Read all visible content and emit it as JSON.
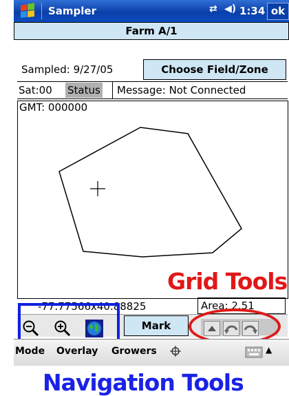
{
  "titlebar": {
    "app_title": "Sampler",
    "time": "1:34",
    "ok_label": "ok",
    "icons": [
      "windows-flag-icon",
      "connectivity-icon",
      "volume-icon"
    ]
  },
  "farm": {
    "title": "Farm A/1"
  },
  "sample": {
    "sampled_label": "Sampled: 9/27/05",
    "choose_button": "Choose Field/Zone"
  },
  "status": {
    "sat": "Sat:00",
    "status_button": "Status",
    "message": "Message: Not Connected"
  },
  "map": {
    "gmt": "GMT: 000000"
  },
  "bottom": {
    "coord": "-77.77566x40.88825",
    "area": "Area: 2.51",
    "mark_button": "Mark"
  },
  "menubar": {
    "items": [
      "Mode",
      "Overlay",
      "Growers"
    ],
    "icons": [
      "gps-icon",
      "keyboard-icon",
      "up-arrow-icon"
    ]
  },
  "annotations": {
    "grid_tools": "Grid Tools",
    "navigation_tools": "Navigation Tools",
    "grid_color": "#e01818",
    "nav_color": "#1a22e6"
  }
}
